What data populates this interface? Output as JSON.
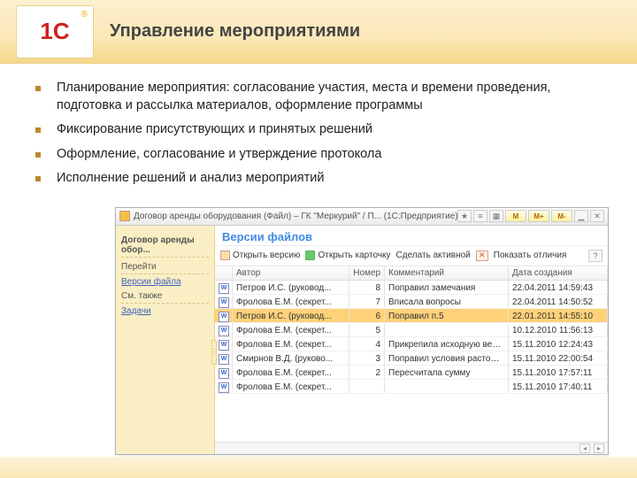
{
  "header": {
    "logo_text": "1C",
    "title": "Управление мероприятиями"
  },
  "bullets": [
    "Планирование мероприятия: согласование участия, места и времени проведения, подготовка и рассылка материалов, оформление программы",
    "Фиксирование присутствующих и принятых решений",
    "Оформление, согласование и утверждение протокола",
    "Исполнение решений и анализ мероприятий"
  ],
  "window": {
    "title": "Договор аренды оборудования (Файл) – ГК \"Меркурий\" / П... (1С:Предприятие)",
    "m_buttons": [
      "M",
      "M+",
      "M-"
    ],
    "sidebar": {
      "top_section": "Договор аренды обор...",
      "go_label": "Перейти",
      "links": [
        "Версии файла"
      ],
      "see_also": "См. также",
      "link2": "Задачи"
    },
    "main": {
      "title": "Версии файлов",
      "toolbar": {
        "open_version": "Открыть версию",
        "open_card": "Открыть карточку",
        "make_active": "Сделать активной",
        "show_diff": "Показать отличия"
      },
      "columns": {
        "author": "Автор",
        "number": "Номер",
        "comment": "Комментарий",
        "created": "Дата создания"
      },
      "rows": [
        {
          "author": "Петров И.С. (руковод...",
          "num": "8",
          "comment": "Поправил замечания",
          "date": "22.04.2011 14:59:43",
          "selected": false
        },
        {
          "author": "Фролова Е.М. (секрет...",
          "num": "7",
          "comment": "Вписала вопросы",
          "date": "22.04.2011 14:50:52",
          "selected": false
        },
        {
          "author": "Петров И.С. (руковод...",
          "num": "6",
          "comment": "Поправил п.5",
          "date": "22.01.2011 14:55:10",
          "selected": true
        },
        {
          "author": "Фролова Е.М. (секрет...",
          "num": "5",
          "comment": "",
          "date": "10.12.2010 11:56:13",
          "selected": false
        },
        {
          "author": "Фролова Е.М. (секрет...",
          "num": "4",
          "comment": "Прикрепила исходную версию",
          "date": "15.11.2010 12:24:43",
          "selected": false
        },
        {
          "author": "Смирнов В.Д. (руково...",
          "num": "3",
          "comment": "Поправил условия расторжения",
          "date": "15.11.2010 22:00:54",
          "selected": false
        },
        {
          "author": "Фролова Е.М. (секрет...",
          "num": "2",
          "comment": "Пересчитала сумму",
          "date": "15.11.2010 17:57:11",
          "selected": false
        },
        {
          "author": "Фролова Е.М. (секрет...",
          "num": "",
          "comment": "",
          "date": "15.11.2010 17:40:11",
          "selected": false
        }
      ]
    }
  }
}
